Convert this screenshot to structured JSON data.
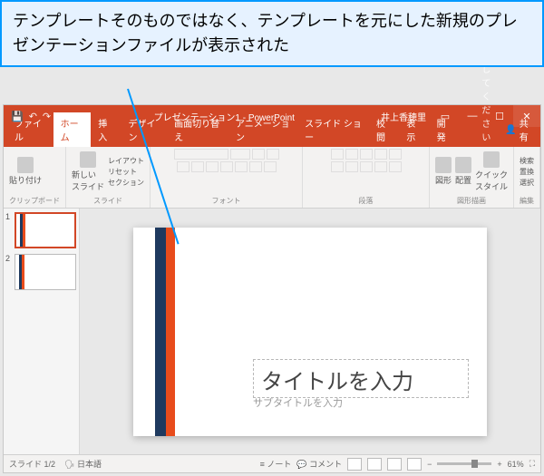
{
  "callout": {
    "text": "テンプレートそのものではなく、テンプレートを元にした新規のプレゼンテーションファイルが表示された"
  },
  "titlebar": {
    "title": "プレゼンテーション1 - PowerPoint",
    "user": "井上香穂里"
  },
  "tabs": {
    "file": "ファイル",
    "home": "ホーム",
    "insert": "挿入",
    "design": "デザイン",
    "transitions": "画面切り替え",
    "animations": "アニメーション",
    "slideshow": "スライド ショー",
    "review": "校閲",
    "view": "表示",
    "developer": "開発",
    "tellme": "実行したい作業を入力してください",
    "share": "共有"
  },
  "ribbon": {
    "clipboard": {
      "label": "クリップボード",
      "paste": "貼り付け"
    },
    "slides": {
      "label": "スライド",
      "newslide": "新しい\nスライド",
      "layout": "レイアウト",
      "reset": "リセット",
      "section": "セクション"
    },
    "font": {
      "label": "フォント"
    },
    "paragraph": {
      "label": "段落"
    },
    "drawing": {
      "label": "図形描画",
      "shapes": "図形",
      "arrange": "配置",
      "quickstyles": "クイック\nスタイル"
    },
    "editing": {
      "label": "編集",
      "find": "検索",
      "replace": "置換",
      "select": "選択"
    }
  },
  "thumbs": {
    "n1": "1",
    "n2": "2"
  },
  "slide": {
    "title_placeholder": "タイトルを入力",
    "subtitle_placeholder": "サブタイトルを入力"
  },
  "statusbar": {
    "slide_indicator": "スライド 1/2",
    "language": "日本語",
    "notes": "ノート",
    "comments": "コメント",
    "zoom": "61%"
  }
}
